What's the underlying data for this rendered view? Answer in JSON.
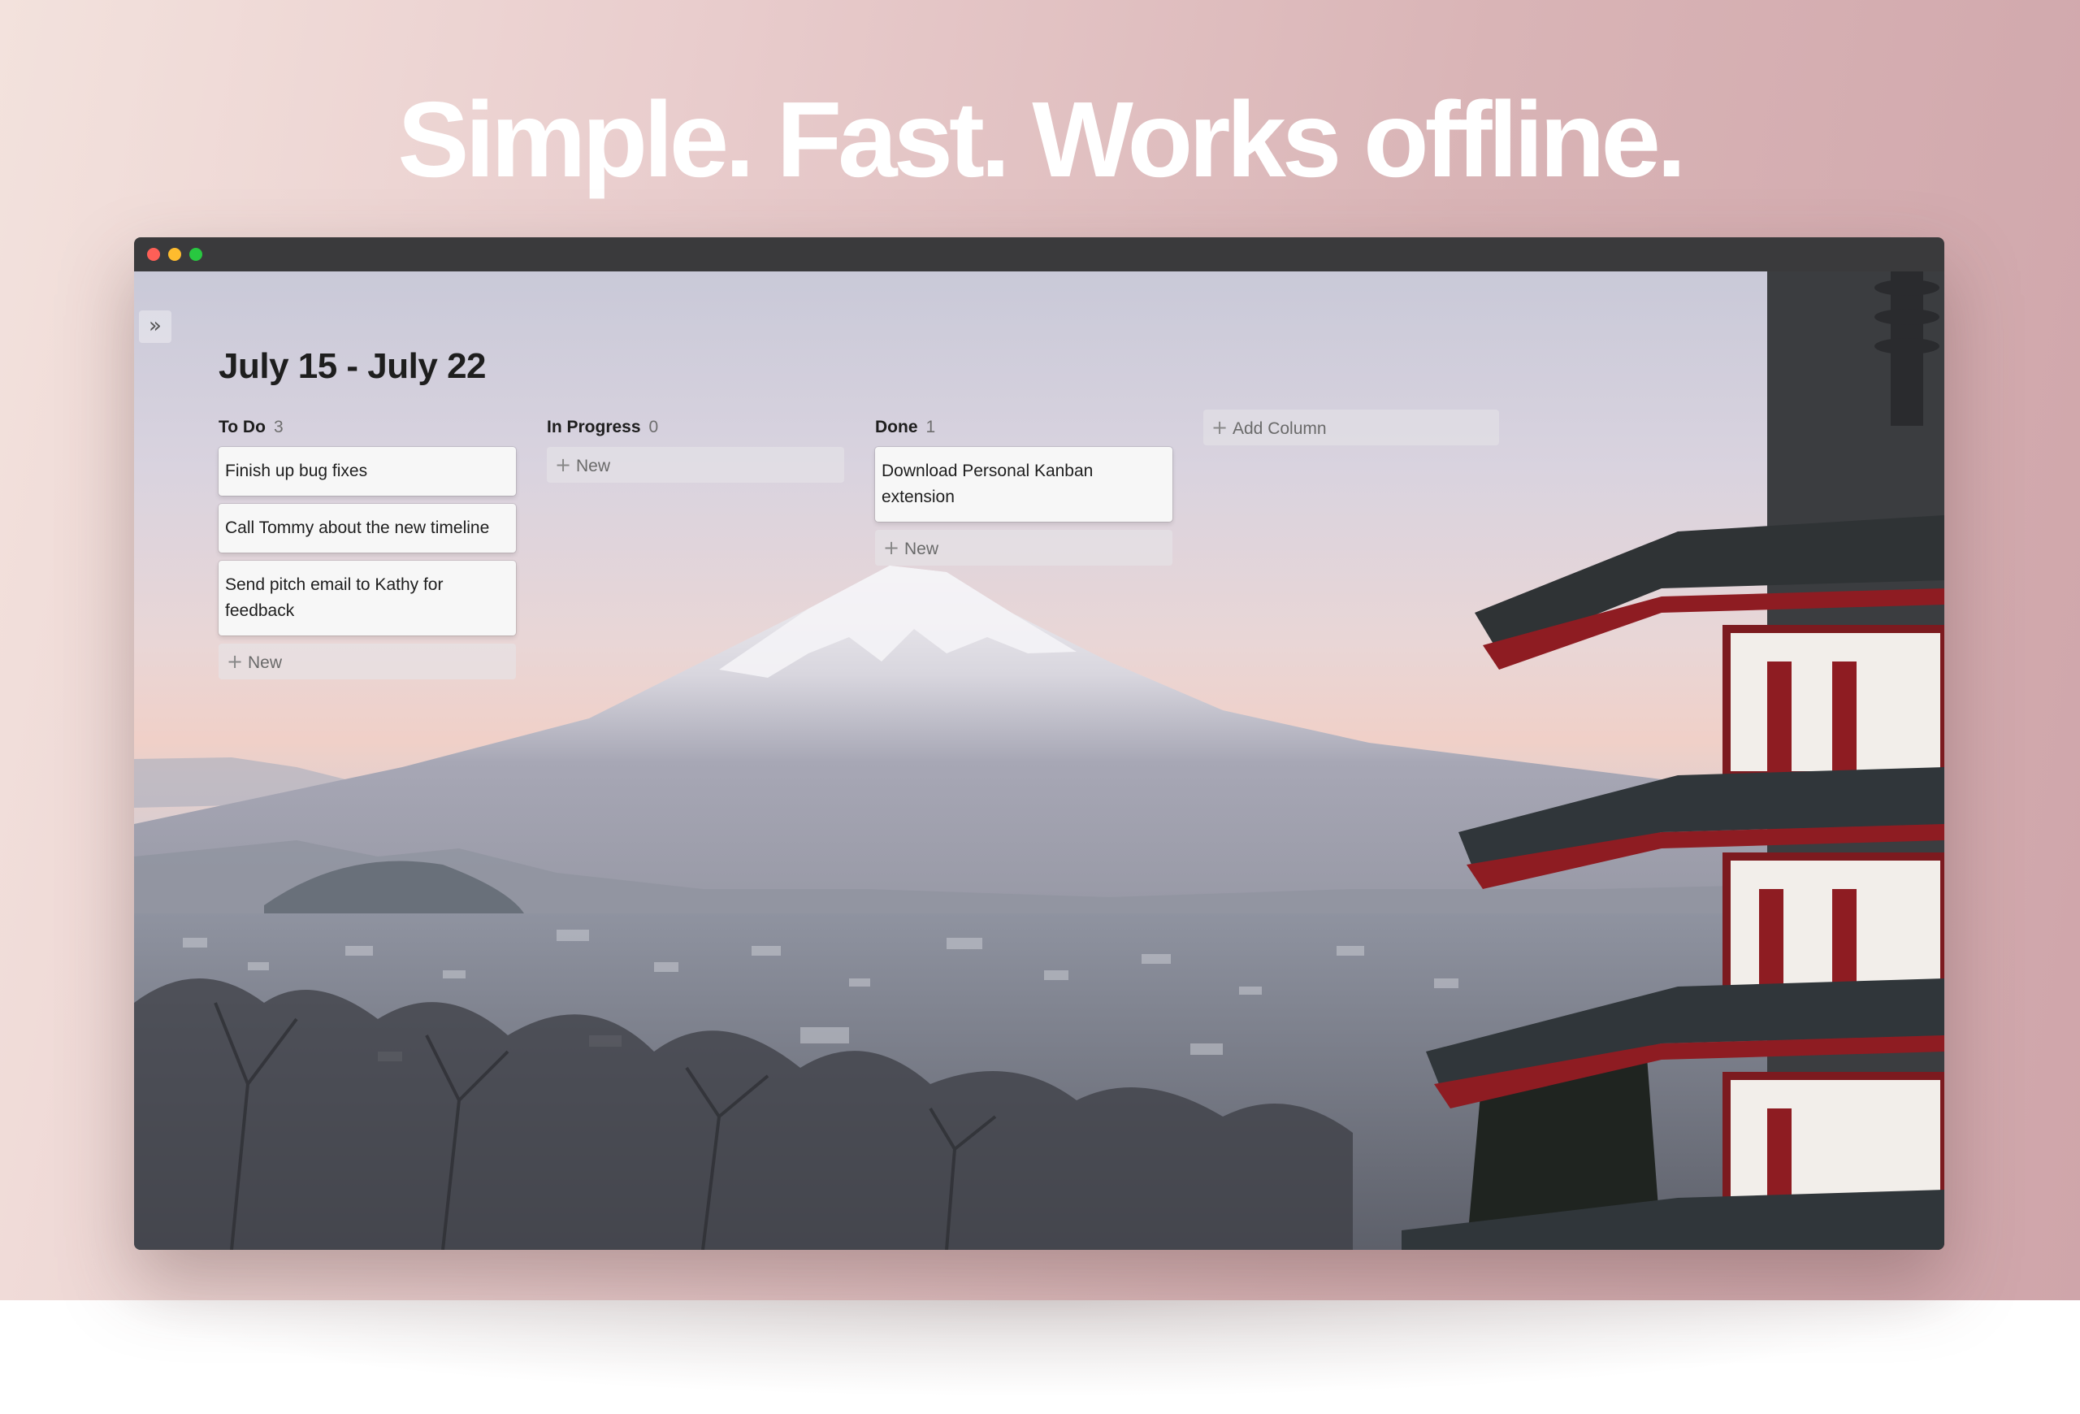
{
  "headline": "Simple. Fast. Works offline.",
  "window": {
    "traffic_lights": [
      "close",
      "minimize",
      "zoom"
    ]
  },
  "board": {
    "sidebar_toggle_icon": "double-chevron-right-icon",
    "title": "July 15 - July 22",
    "new_label": "New",
    "add_column_label": "Add Column",
    "columns": [
      {
        "name": "To Do",
        "count": "3",
        "cards": [
          "Finish up bug fixes",
          "Call Tommy about the new timeline",
          "Send pitch email to Kathy for feedback"
        ]
      },
      {
        "name": "In Progress",
        "count": "0",
        "cards": []
      },
      {
        "name": "Done",
        "count": "1",
        "cards": [
          "Download Personal Kanban extension"
        ]
      }
    ]
  },
  "colors": {
    "card_bg": "#f7f7f7",
    "text": "#1e1e1e",
    "titlebar": "#3a3a3c"
  }
}
